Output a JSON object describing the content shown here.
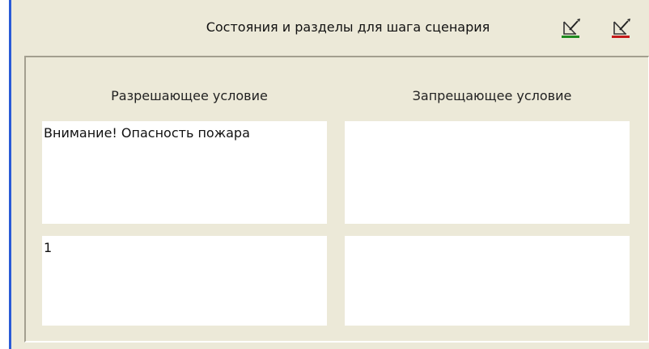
{
  "header": {
    "title": "Состояния и разделы для шага сценария",
    "button_green_icon": "edit-allow-icon",
    "button_red_icon": "edit-deny-icon"
  },
  "columns": {
    "allow_label": "Разрешающее условие",
    "deny_label": "Запрещающее условие"
  },
  "cells": {
    "allow_state": "Внимание! Опасность пожара",
    "deny_state": "",
    "allow_section": "1",
    "deny_section": ""
  },
  "colors": {
    "panel_bg": "#ece9d8",
    "accent_bar": "#2a5bd7",
    "icon_green": "#1f8a1f",
    "icon_red": "#c41a1a"
  }
}
